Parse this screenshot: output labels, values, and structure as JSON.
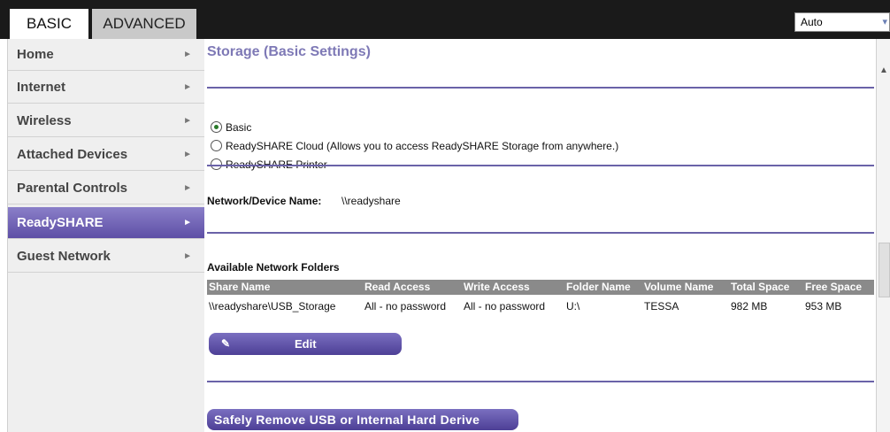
{
  "tabs": {
    "basic": "BASIC",
    "advanced": "ADVANCED"
  },
  "language": {
    "value": "Auto"
  },
  "sidebar": {
    "items": [
      {
        "label": "Home"
      },
      {
        "label": "Internet"
      },
      {
        "label": "Wireless"
      },
      {
        "label": "Attached Devices"
      },
      {
        "label": "Parental Controls"
      },
      {
        "label": "ReadySHARE"
      },
      {
        "label": "Guest Network"
      }
    ],
    "active": "ReadySHARE"
  },
  "page": {
    "title": "Storage (Basic Settings)",
    "radios": [
      {
        "label": "Basic",
        "selected": true
      },
      {
        "label": "ReadySHARE Cloud (Allows you to access ReadySHARE Storage from anywhere.)",
        "selected": false
      },
      {
        "label": "ReadySHARE Printer",
        "selected": false
      }
    ],
    "device_name_label": "Network/Device Name:",
    "device_name_value": "\\\\readyshare",
    "folders_heading": "Available Network Folders",
    "table": {
      "headers": [
        "Share Name",
        "Read Access",
        "Write Access",
        "Folder Name",
        "Volume Name",
        "Total Space",
        "Free Space"
      ],
      "rows": [
        [
          "\\\\readyshare\\USB_Storage",
          "All - no password",
          "All - no password",
          "U:\\",
          "TESSA",
          "982 MB",
          "953 MB"
        ]
      ]
    },
    "edit_button": "Edit",
    "remove_button": "Safely Remove USB or Internal Hard Derive"
  },
  "colors": {
    "accent": "#6a62a8",
    "title": "#7e79b6",
    "topbar": "#1a1a1a"
  }
}
